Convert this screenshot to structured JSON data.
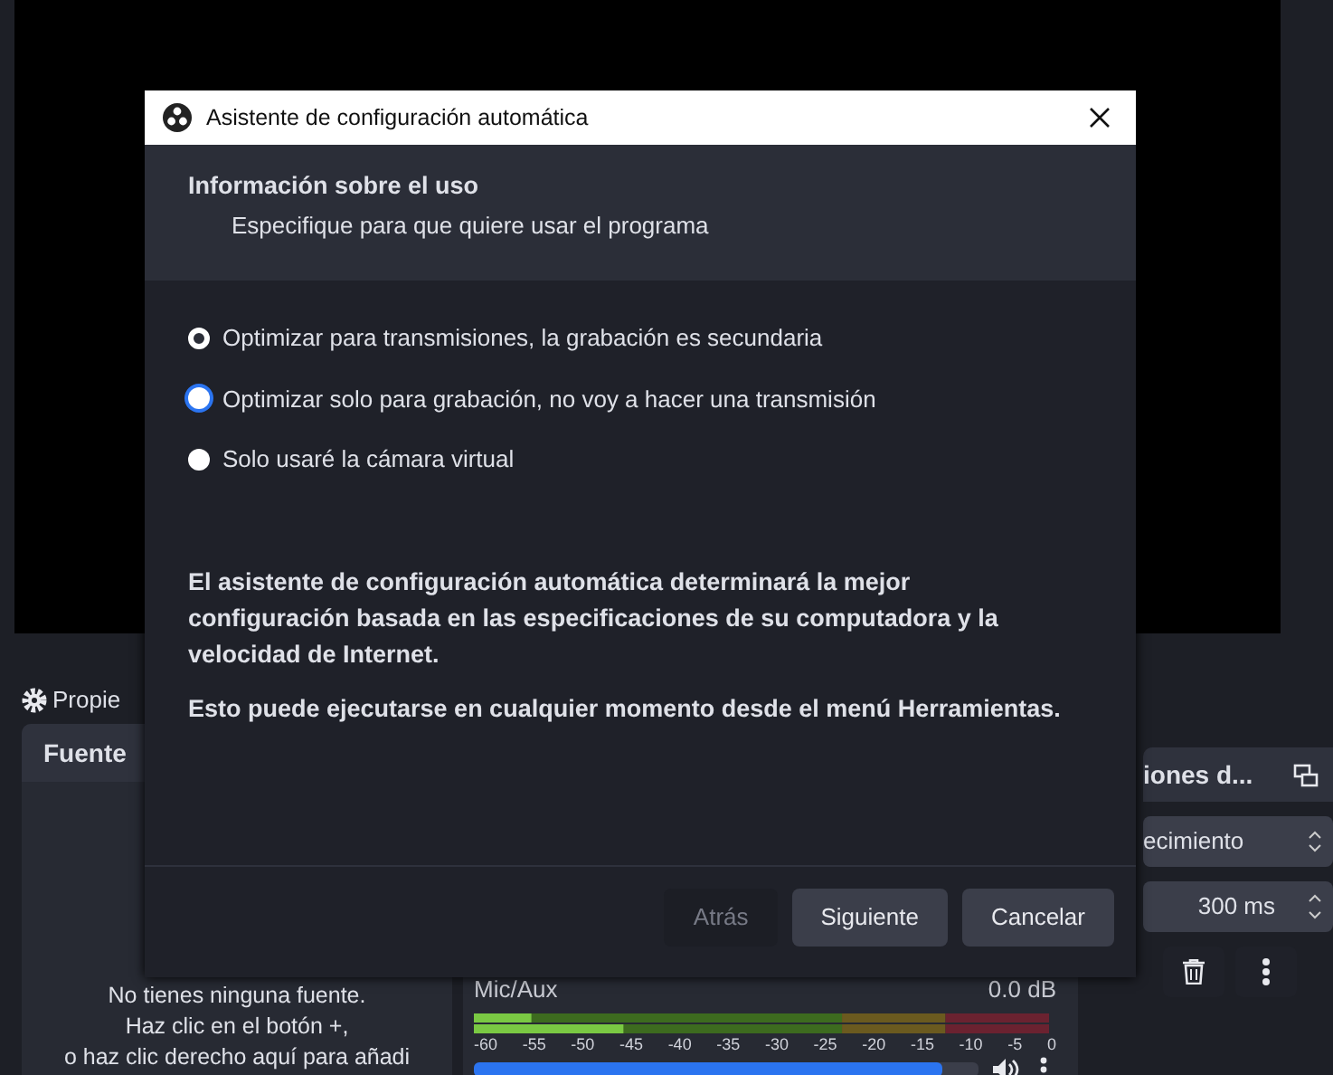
{
  "dock_tab": {
    "label": "Propie"
  },
  "sources_panel": {
    "title": "Fuente",
    "empty_message": [
      "No tienes ninguna fuente.",
      "Haz clic en el botón +,",
      "o haz clic derecho aquí para añadi"
    ]
  },
  "mixer": {
    "channel": {
      "name": "Mic/Aux",
      "reading": "0.0 dB",
      "meters": [
        {
          "level": 0.1
        },
        {
          "level": 0.26
        }
      ],
      "scale": [
        "-60",
        "-55",
        "-50",
        "-45",
        "-40",
        "-35",
        "-30",
        "-25",
        "-20",
        "-15",
        "-10",
        "-5",
        "0"
      ],
      "volume": {
        "level": 0.93
      }
    }
  },
  "transitions_panel": {
    "title": "iones d...",
    "transition": "ecimiento",
    "duration": "300 ms"
  },
  "dialog": {
    "title": "Asistente de configuración automática",
    "heading": "Información sobre el uso",
    "subheading": "Especifique para que quiere usar el programa",
    "options": [
      {
        "label": "Optimizar para transmisiones, la grabación es secundaria",
        "selected": true,
        "focused": false
      },
      {
        "label": "Optimizar solo para grabación, no voy a hacer una transmisión",
        "selected": false,
        "focused": true
      },
      {
        "label": "Solo usaré la cámara virtual",
        "selected": false,
        "focused": false
      }
    ],
    "paragraphs": [
      "El asistente de configuración automática determinará la mejor configuración basada en las especificaciones de su computadora y la velocidad de Internet.",
      "Esto puede ejecutarse en cualquier momento desde el menú Herramientas."
    ],
    "buttons": [
      {
        "label": "Atrás",
        "disabled": true
      },
      {
        "label": "Siguiente",
        "disabled": false
      },
      {
        "label": "Cancelar",
        "disabled": false
      }
    ]
  }
}
